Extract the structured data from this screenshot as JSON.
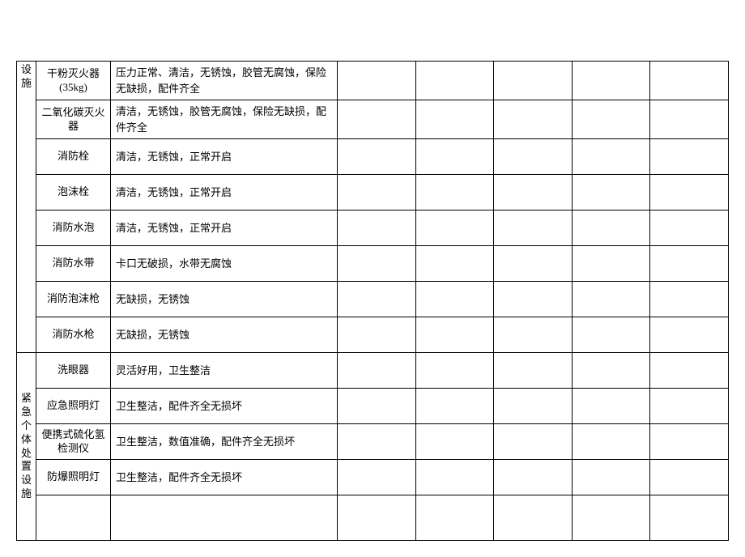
{
  "sections": {
    "fire": {
      "label": "设施",
      "rows": [
        {
          "item_line1": "干粉灭火器",
          "item_line2": "(35kg)",
          "desc": "压力正常、清洁，无锈蚀，胶管无腐蚀，保险无缺损，配件齐全"
        },
        {
          "item_line1": "二氧化碳灭火",
          "item_line2": "器",
          "desc": "清洁，无锈蚀，胶管无腐蚀，保险无缺损，配件齐全"
        },
        {
          "item": "消防栓",
          "desc": "清洁，无锈蚀，正常开启"
        },
        {
          "item": "泡沫栓",
          "desc": "清洁，无锈蚀，正常开启"
        },
        {
          "item": "消防水泡",
          "desc": "清洁，无锈蚀，正常开启"
        },
        {
          "item": "消防水带",
          "desc": "卡口无破损，水带无腐蚀"
        },
        {
          "item": "消防泡沫枪",
          "desc": "无缺损，无锈蚀"
        },
        {
          "item": "消防水枪",
          "desc": "无缺损，无锈蚀"
        }
      ]
    },
    "emergency": {
      "label": "紧急个体处置设施",
      "rows": [
        {
          "item": "洗眼器",
          "desc": "灵活好用，卫生整洁"
        },
        {
          "item": "应急照明灯",
          "desc": "卫生整洁，配件齐全无损坏"
        },
        {
          "item_line1": "便携式硫化氢",
          "item_line2": "检测仪",
          "desc": "卫生整洁，数值准确，配件齐全无损坏"
        },
        {
          "item": "防爆照明灯",
          "desc": "卫生整洁，配件齐全无损坏"
        }
      ]
    }
  }
}
